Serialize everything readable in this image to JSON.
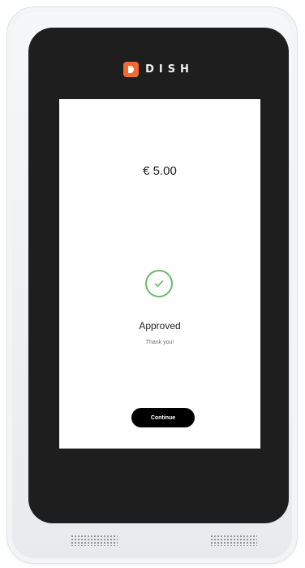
{
  "brand": {
    "name": "DISH",
    "accent_color": "#f26a2c",
    "logo_icon": "dish-logo-icon"
  },
  "payment": {
    "amount": "€ 5.00",
    "status_title": "Approved",
    "status_subtitle": "Thank you!",
    "status_icon": "check-circle-icon",
    "status_color": "#66bb6a"
  },
  "actions": {
    "continue_label": "Continue"
  }
}
